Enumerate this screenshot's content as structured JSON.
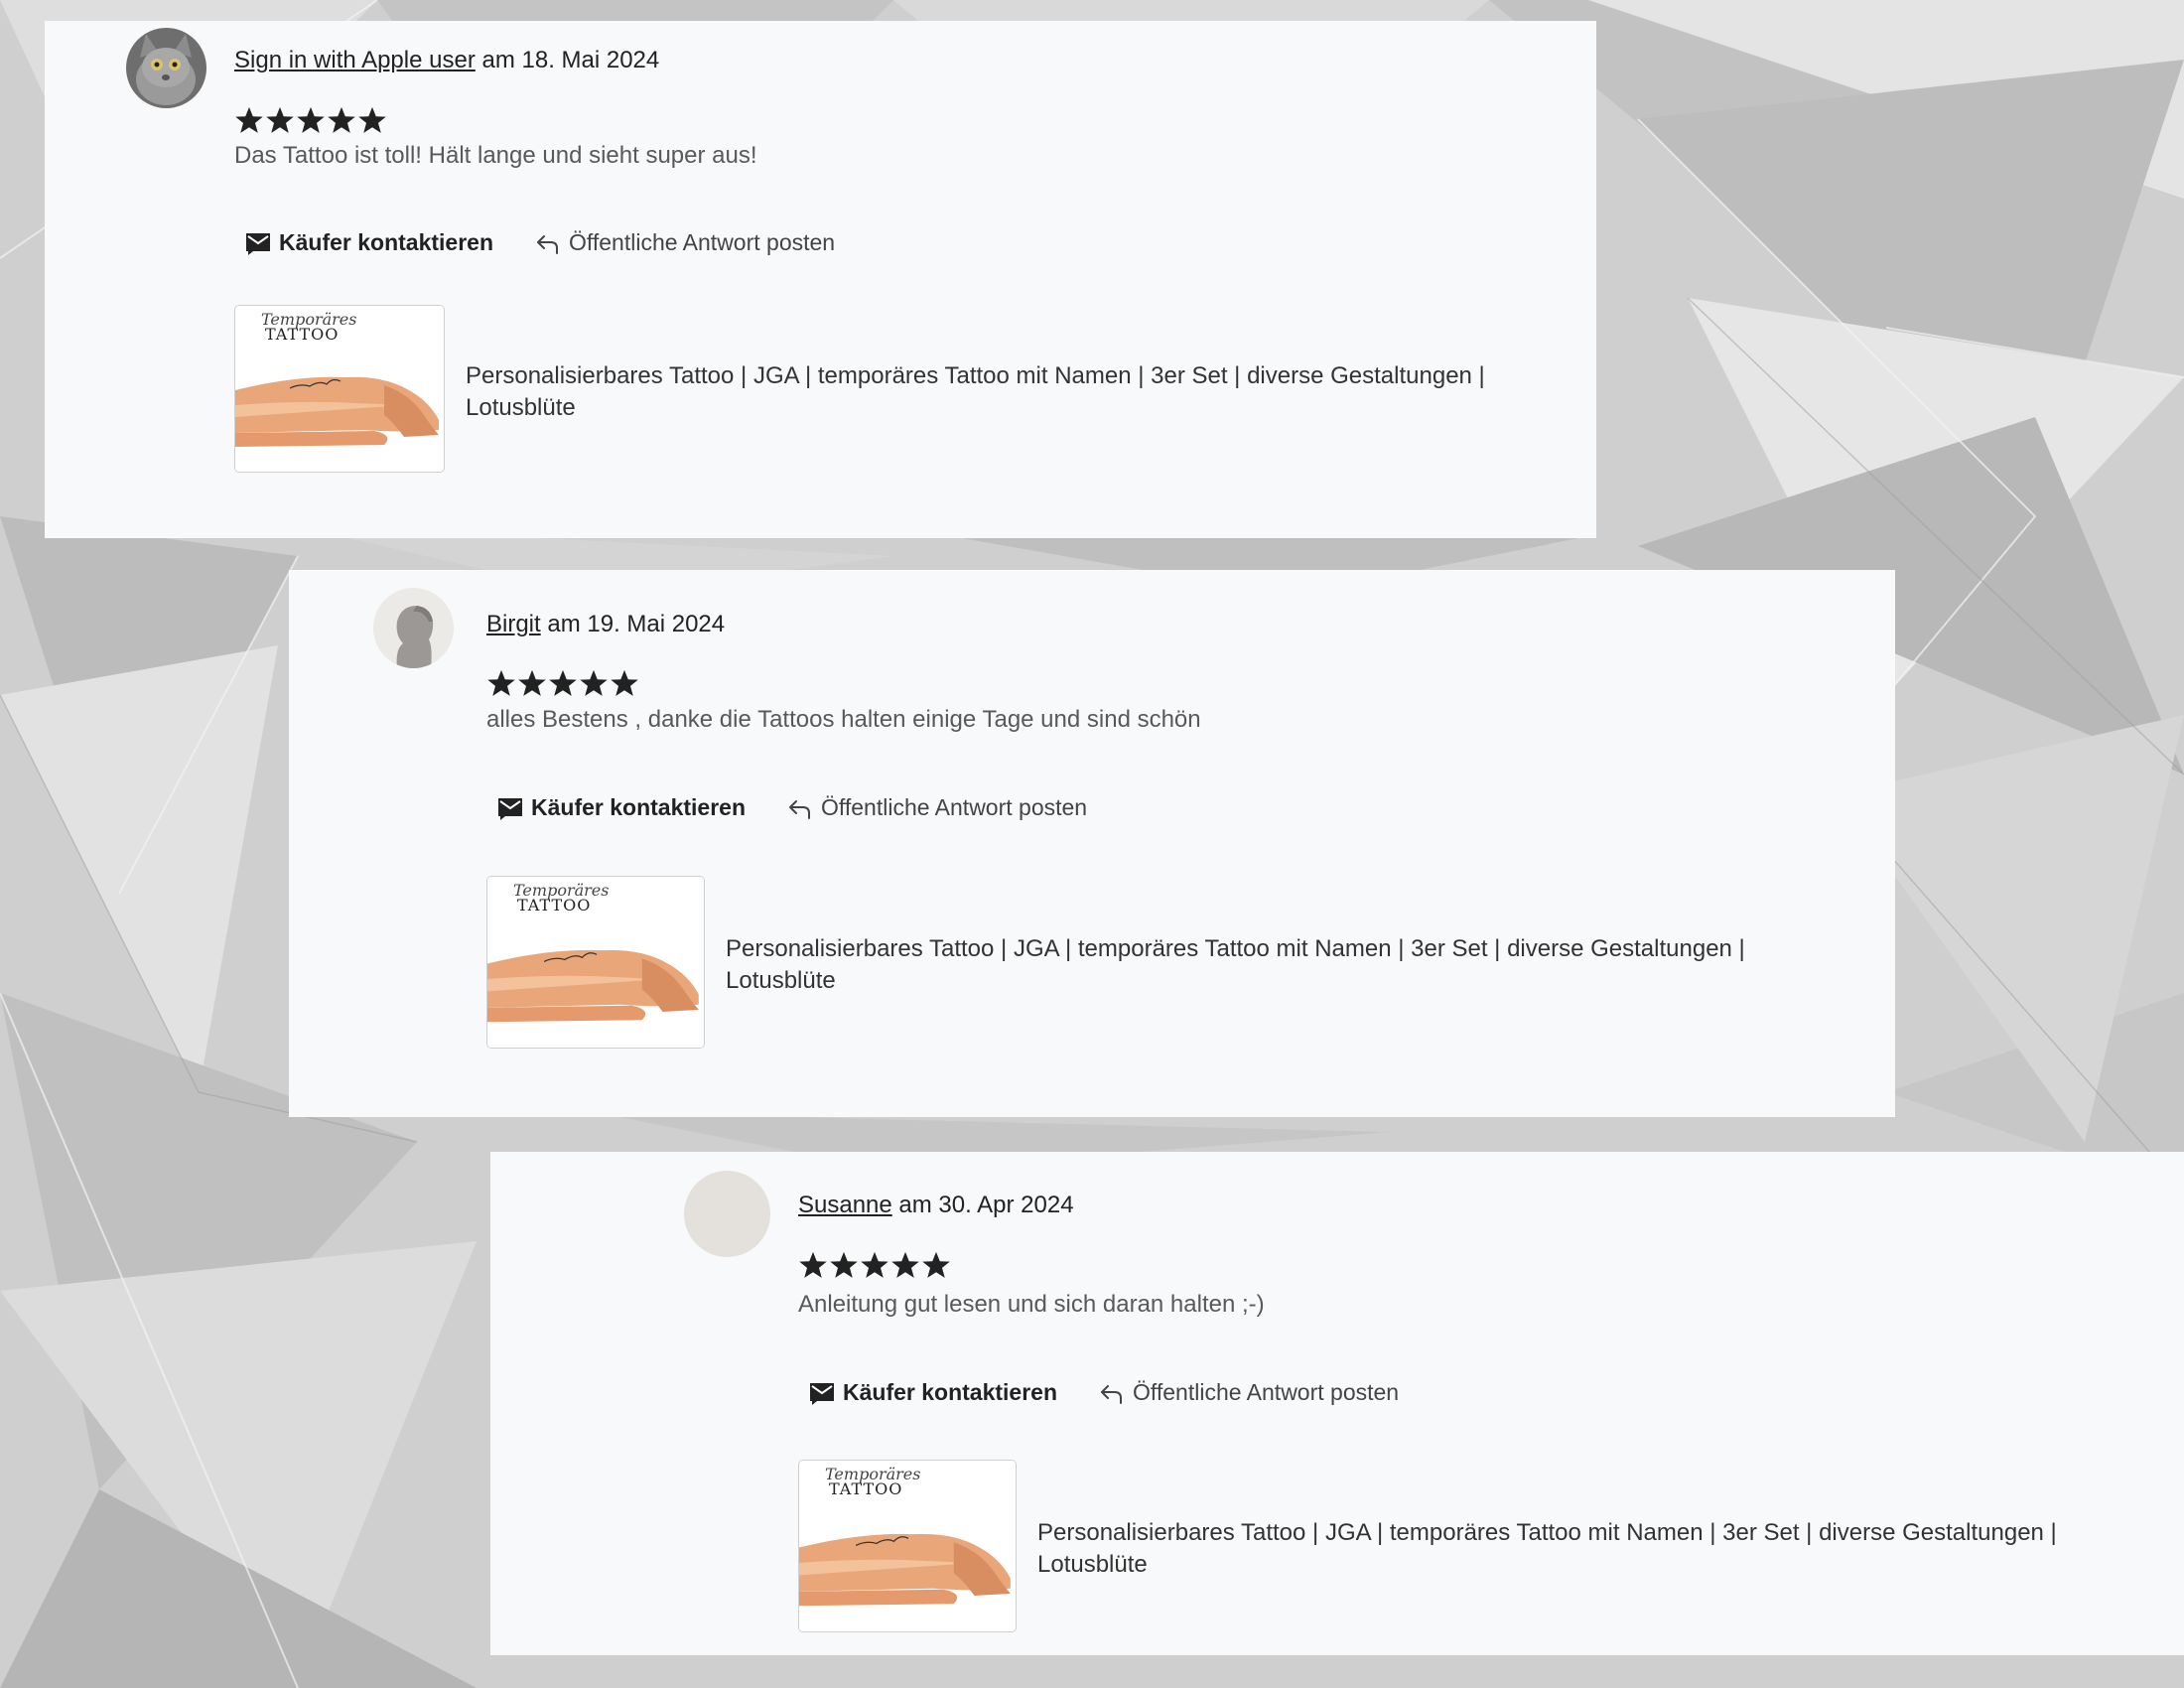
{
  "reviews": [
    {
      "user": "Sign in with Apple user",
      "date_text": "am 18. Mai 2024",
      "rating": 5,
      "text": "Das Tattoo ist toll! Hält lange und sieht super aus!",
      "avatar": "cat-photo",
      "actions": {
        "contact": "Käufer kontaktieren",
        "reply": "Öffentliche Antwort posten"
      },
      "listing": {
        "title_line1": "Personalisierbares Tattoo | JGA | temporäres Tattoo mit Namen | 3er Set | diverse Gestaltungen |",
        "title_line2": "Lotusblüte",
        "thumb_script": "Temporäres",
        "thumb_word": "TATTOO"
      }
    },
    {
      "user": "Birgit",
      "date_text": "am 19. Mai 2024",
      "rating": 5,
      "text": "alles Bestens , danke die Tattoos halten einige Tage und sind schön",
      "avatar": "default-silhouette",
      "actions": {
        "contact": "Käufer kontaktieren",
        "reply": "Öffentliche Antwort posten"
      },
      "listing": {
        "title_line1": "Personalisierbares Tattoo | JGA | temporäres Tattoo mit Namen | 3er Set | diverse Gestaltungen |",
        "title_line2": "Lotusblüte",
        "thumb_script": "Temporäres",
        "thumb_word": "TATTOO"
      }
    },
    {
      "user": "Susanne",
      "date_text": "am 30. Apr 2024",
      "rating": 5,
      "text": "Anleitung gut lesen und sich daran halten ;-)",
      "avatar": "blank",
      "actions": {
        "contact": "Käufer kontaktieren",
        "reply": "Öffentliche Antwort posten"
      },
      "listing": {
        "title_line1": "Personalisierbares Tattoo | JGA | temporäres Tattoo mit Namen | 3er Set | diverse Gestaltungen |",
        "title_line2": "Lotusblüte",
        "thumb_script": "Temporäres",
        "thumb_word": "TATTOO"
      }
    }
  ],
  "colors": {
    "card_bg": "#f8f9fa",
    "star": "#222222",
    "text_muted": "#595959",
    "background": "crumpled-paper-grey"
  }
}
